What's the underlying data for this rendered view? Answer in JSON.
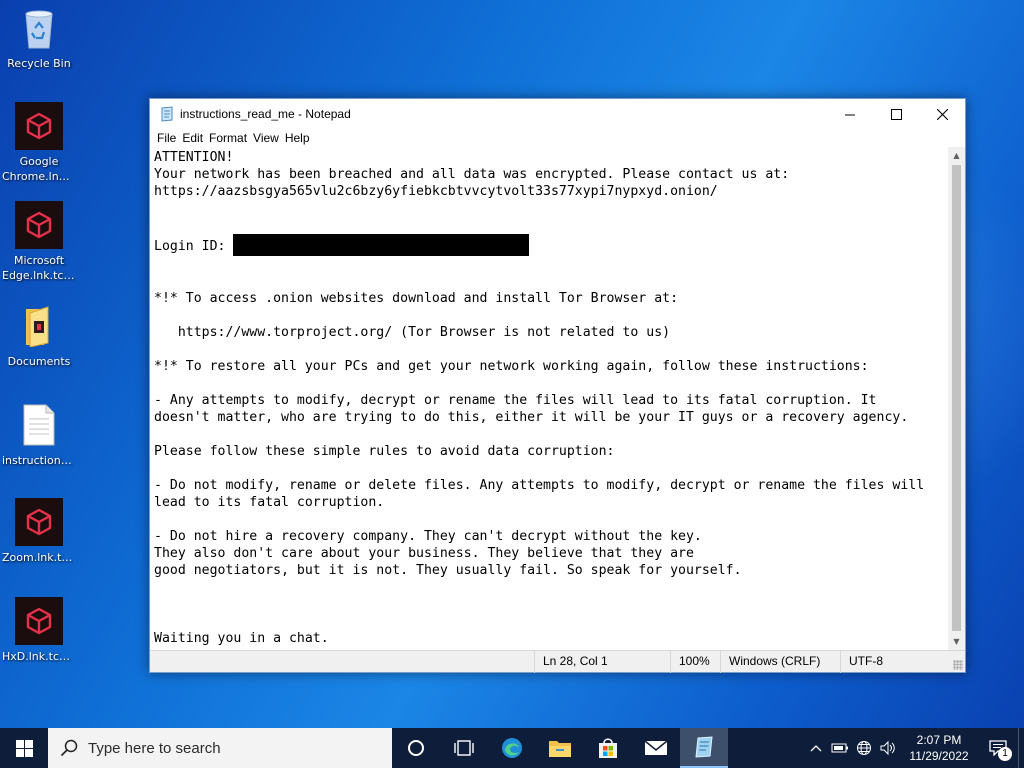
{
  "desktop": {
    "icons": [
      {
        "label": "Recycle Bin",
        "label2": ""
      },
      {
        "label": "Google",
        "label2": "Chrome.lnk...."
      },
      {
        "label": "Microsoft",
        "label2": "Edge.lnk.tcw..."
      },
      {
        "label": "Documents",
        "label2": ""
      },
      {
        "label": "instructions...",
        "label2": ""
      },
      {
        "label": "Zoom.lnk.tc...",
        "label2": ""
      },
      {
        "label": "HxD.lnk.tcw...",
        "label2": ""
      }
    ],
    "colors": {
      "background": "#0f6fd6",
      "icon_red": "#e8304a"
    }
  },
  "notepad": {
    "title": "instructions_read_me - Notepad",
    "menu": [
      "File",
      "Edit",
      "Format",
      "View",
      "Help"
    ],
    "content": {
      "line1": "ATTENTION!",
      "line2": "Your network has been breached and all data was encrypted. Please contact us at:",
      "line3": "https://aazsbsgya565vlu2c6bzy6yfiebkcbtvvcytvolt33s77xypi7nypxyd.onion/",
      "login_label": "Login ID: ",
      "tor_header": "*!* To access .onion websites download and install Tor Browser at:",
      "tor_link": "   https://www.torproject.org/ (Tor Browser is not related to us)",
      "restore_header": "*!* To restore all your PCs and get your network working again, follow these instructions:",
      "warn1": "- Any attempts to modify, decrypt or rename the files will lead to its fatal corruption. It",
      "warn2": "doesn't matter, who are trying to do this, either it will be your IT guys or a recovery agency.",
      "rules_header": "Please follow these simple rules to avoid data corruption:",
      "rule1a": "- Do not modify, rename or delete files. Any attempts to modify, decrypt or rename the files will",
      "rule1b": "lead to its fatal corruption.",
      "rule2a": "- Do not hire a recovery company. They can't decrypt without the key.",
      "rule2b": "They also don't care about your business. They believe that they are",
      "rule2c": "good negotiators, but it is not. They usually fail. So speak for yourself.",
      "footer": "Waiting you in a chat."
    },
    "status": {
      "position": "Ln 28, Col 1",
      "zoom": "100%",
      "line_endings": "Windows (CRLF)",
      "encoding": "UTF-8"
    }
  },
  "taskbar": {
    "search_placeholder": "Type here to search",
    "time": "2:07 PM",
    "date": "11/29/2022",
    "notification_count": "1",
    "apps": [
      "cortana-icon",
      "task-view-icon",
      "edge-icon",
      "file-explorer-icon",
      "store-icon",
      "mail-icon",
      "notepad-icon"
    ]
  }
}
